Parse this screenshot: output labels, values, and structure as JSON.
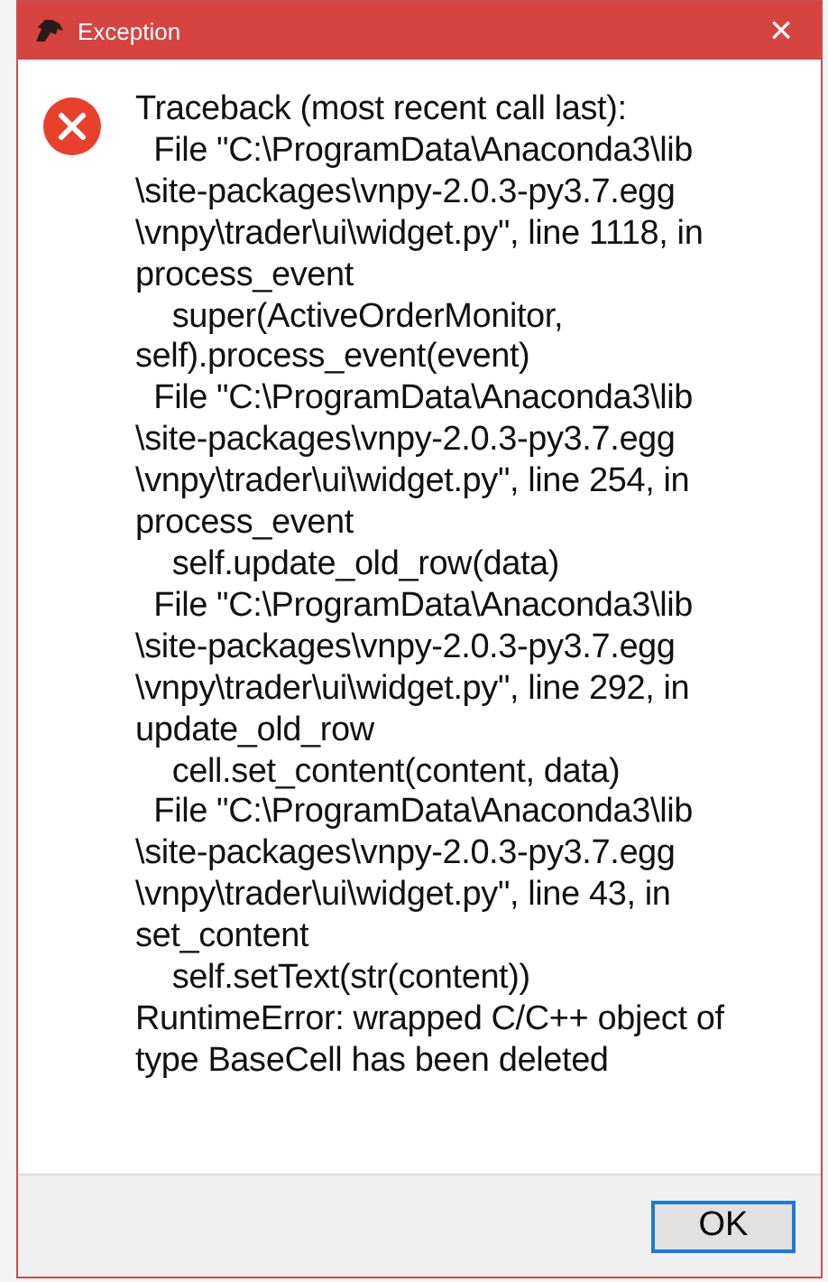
{
  "dialog": {
    "title": "Exception",
    "message": "Traceback (most recent call last):\n  File \"C:\\ProgramData\\Anaconda3\\lib\n\\site-packages\\vnpy-2.0.3-py3.7.egg\n\\vnpy\\trader\\ui\\widget.py\", line 1118, in\nprocess_event\n    super(ActiveOrderMonitor,\nself).process_event(event)\n  File \"C:\\ProgramData\\Anaconda3\\lib\n\\site-packages\\vnpy-2.0.3-py3.7.egg\n\\vnpy\\trader\\ui\\widget.py\", line 254, in\nprocess_event\n    self.update_old_row(data)\n  File \"C:\\ProgramData\\Anaconda3\\lib\n\\site-packages\\vnpy-2.0.3-py3.7.egg\n\\vnpy\\trader\\ui\\widget.py\", line 292, in\nupdate_old_row\n    cell.set_content(content, data)\n  File \"C:\\ProgramData\\Anaconda3\\lib\n\\site-packages\\vnpy-2.0.3-py3.7.egg\n\\vnpy\\trader\\ui\\widget.py\", line 43, in\nset_content\n    self.setText(str(content))\nRuntimeError: wrapped C/C++ object of\ntype BaseCell has been deleted",
    "close_symbol": "×",
    "buttons": [
      "OK"
    ]
  }
}
